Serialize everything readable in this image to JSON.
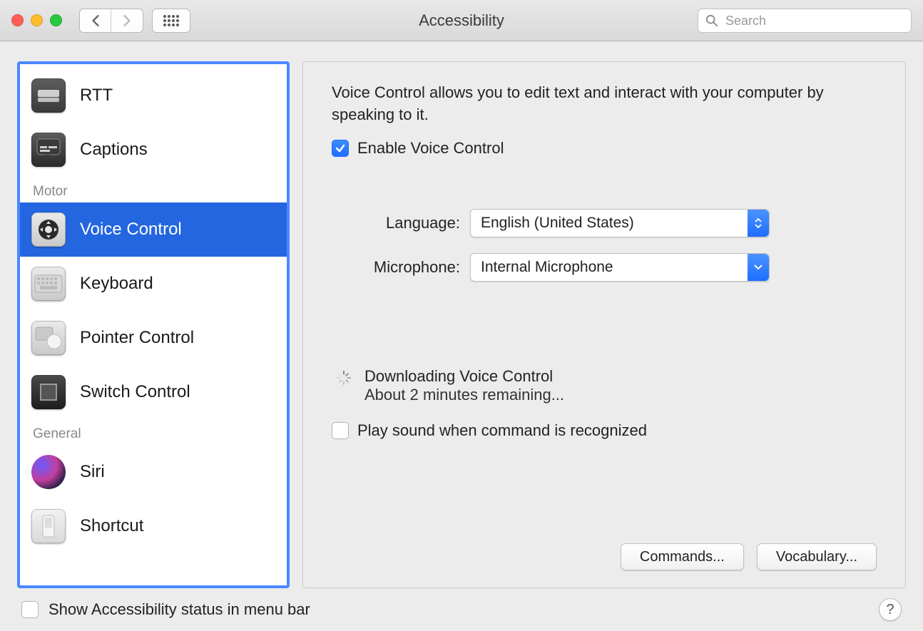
{
  "window": {
    "title": "Accessibility",
    "search_placeholder": "Search"
  },
  "sidebar": {
    "groups": [
      {
        "heading": null,
        "items": [
          {
            "id": "rtt",
            "label": "RTT",
            "icon": "rtt-icon"
          },
          {
            "id": "captions",
            "label": "Captions",
            "icon": "captions-icon"
          }
        ]
      },
      {
        "heading": "Motor",
        "items": [
          {
            "id": "voice-control",
            "label": "Voice Control",
            "icon": "voice-control-icon",
            "selected": true
          },
          {
            "id": "keyboard",
            "label": "Keyboard",
            "icon": "keyboard-icon"
          },
          {
            "id": "pointer-control",
            "label": "Pointer Control",
            "icon": "pointer-control-icon"
          },
          {
            "id": "switch-control",
            "label": "Switch Control",
            "icon": "switch-control-icon"
          }
        ]
      },
      {
        "heading": "General",
        "items": [
          {
            "id": "siri",
            "label": "Siri",
            "icon": "siri-icon"
          },
          {
            "id": "shortcut",
            "label": "Shortcut",
            "icon": "shortcut-icon"
          }
        ]
      }
    ]
  },
  "panel": {
    "description": "Voice Control allows you to edit text and interact with your computer by speaking to it.",
    "enable_checkbox": {
      "label": "Enable Voice Control",
      "checked": true
    },
    "rows": {
      "language": {
        "label": "Language:",
        "value": "English (United States)"
      },
      "microphone": {
        "label": "Microphone:",
        "value": "Internal Microphone"
      }
    },
    "download": {
      "title": "Downloading Voice Control",
      "subtitle": "About 2 minutes remaining..."
    },
    "play_sound_checkbox": {
      "label": "Play sound when command is recognized",
      "checked": false
    },
    "buttons": {
      "commands": "Commands...",
      "vocabulary": "Vocabulary..."
    }
  },
  "footer": {
    "checkbox": {
      "label": "Show Accessibility status in menu bar",
      "checked": false
    },
    "help": "?"
  }
}
